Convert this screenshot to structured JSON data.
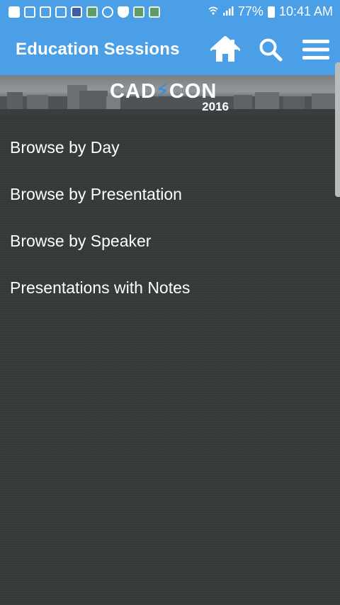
{
  "status_bar": {
    "battery": "77%",
    "time": "10:41 AM",
    "notification_icons": [
      "chat-icon",
      "cast-icon",
      "cast-icon",
      "image-icon",
      "news-app-icon",
      "app-icon",
      "app-icon",
      "shield-app-icon",
      "app-icon",
      "app-icon"
    ]
  },
  "app_bar": {
    "title": "Education Sessions",
    "actions": [
      "home-icon",
      "search-icon",
      "menu-icon"
    ]
  },
  "banner": {
    "logo_main_left": "CAD",
    "logo_main_right": "CON",
    "logo_year": "2016"
  },
  "menu": {
    "items": [
      {
        "label": "Browse by Day"
      },
      {
        "label": "Browse by Presentation"
      },
      {
        "label": "Browse by Speaker"
      },
      {
        "label": "Presentations with Notes"
      }
    ]
  },
  "colors": {
    "header_blue": "#4a9fe6",
    "background": "#363a38",
    "text": "#ffffff",
    "logo_bolt": "#2f8de4"
  }
}
